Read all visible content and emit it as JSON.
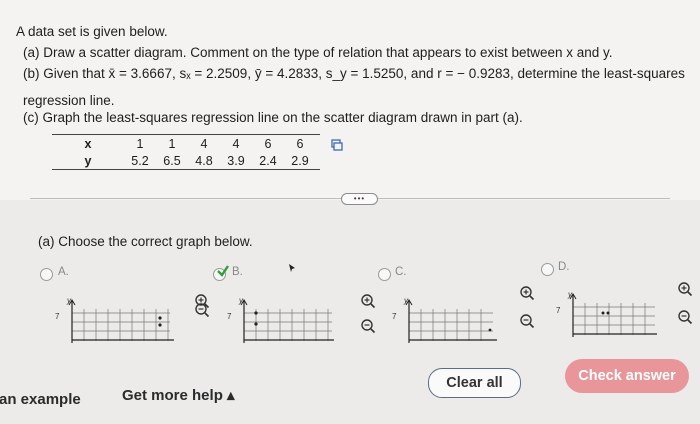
{
  "problem": {
    "intro": "A data set is given below.",
    "part_a": "(a) Draw a scatter diagram. Comment on the type of relation that appears to exist between x and y.",
    "part_b": "(b) Given that x̄ = 3.6667, sₓ = 2.2509, ȳ = 4.2833, s_y = 1.5250, and r = − 0.9283, determine the least-squares",
    "part_b_cont": "regression line.",
    "part_c": "(c) Graph the least-squares regression line on the scatter diagram drawn in part (a)."
  },
  "table": {
    "x_label": "x",
    "y_label": "y",
    "x_values": [
      "1",
      "1",
      "4",
      "4",
      "6",
      "6"
    ],
    "y_values": [
      "5.2",
      "6.5",
      "4.8",
      "3.9",
      "2.4",
      "2.9"
    ]
  },
  "more_button": "•••",
  "part_a_prompt": "(a) Choose the correct graph below.",
  "options": [
    {
      "letter": "A.",
      "y_tick": "7",
      "axis": "y",
      "selected": false
    },
    {
      "letter": "B.",
      "y_tick": "7",
      "axis": "y",
      "selected": true
    },
    {
      "letter": "C.",
      "y_tick": "7",
      "axis": "y",
      "selected": false
    },
    {
      "letter": "D.",
      "y_tick": "7",
      "axis": "y",
      "selected": false
    }
  ],
  "footer": {
    "example": "an example",
    "get_help": "Get more help ▴",
    "clear_all": "Clear all",
    "check_answer": "Check answer"
  },
  "colors": {
    "check_button": "#e9969a",
    "selected_check": "#2e9e3b",
    "clear_border": "#5b6b8a"
  }
}
